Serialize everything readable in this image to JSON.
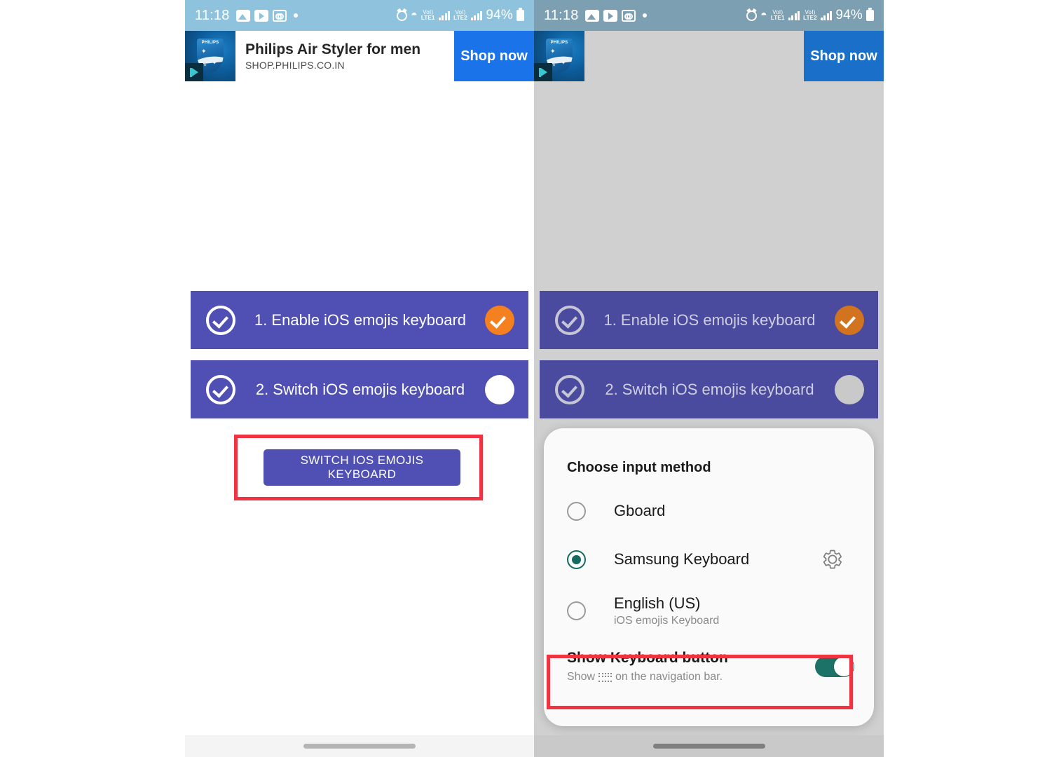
{
  "statusbar": {
    "time": "11:18",
    "battery_percent": "94%",
    "network_1": "LTE1",
    "network_2": "LTE2",
    "volte_label": "VoI)",
    "icons": [
      "photos-icon",
      "youtube-icon",
      "voicemail-icon",
      "notification-dot",
      "alarm-icon",
      "wifi-icon",
      "signal-bars-icon",
      "battery-icon"
    ]
  },
  "ad": {
    "brand": "PHILIPS",
    "title": "Philips Air Styler for men",
    "url": "SHOP.PHILIPS.CO.IN",
    "cta": "Shop now",
    "adchoices_icon": "adchoices-icon"
  },
  "steps": [
    {
      "label": "1. Enable iOS emojis keyboard",
      "state": "done"
    },
    {
      "label": "2. Switch iOS emojis keyboard",
      "state": "pending"
    }
  ],
  "primary_button": {
    "label": "SWITCH IOS EMOJIS KEYBOARD"
  },
  "dialog": {
    "title": "Choose input method",
    "options": [
      {
        "label": "Gboard",
        "sub": "",
        "selected": false,
        "has_gear": false
      },
      {
        "label": "Samsung Keyboard",
        "sub": "",
        "selected": true,
        "has_gear": true
      },
      {
        "label": "English (US)",
        "sub": "iOS emojis Keyboard",
        "selected": false,
        "has_gear": false
      }
    ],
    "toggle_setting": {
      "title": "Show Keyboard button",
      "sub_prefix": "Show",
      "sub_suffix": "on the navigation bar.",
      "enabled": true
    }
  },
  "colors": {
    "card_purple": "#5050b4",
    "card_purple_dim": "#4a4a9e",
    "accent_orange": "#f58020",
    "highlight_red": "#ef3340",
    "toggle_teal": "#1d7268",
    "radio_teal": "#15695f",
    "ad_cta_blue": "#1a73e8",
    "statusbar_blue": "#8fc3dd",
    "statusbar_blue_dim": "#7c9fb1",
    "scrim_grey": "#d0d0d0"
  }
}
